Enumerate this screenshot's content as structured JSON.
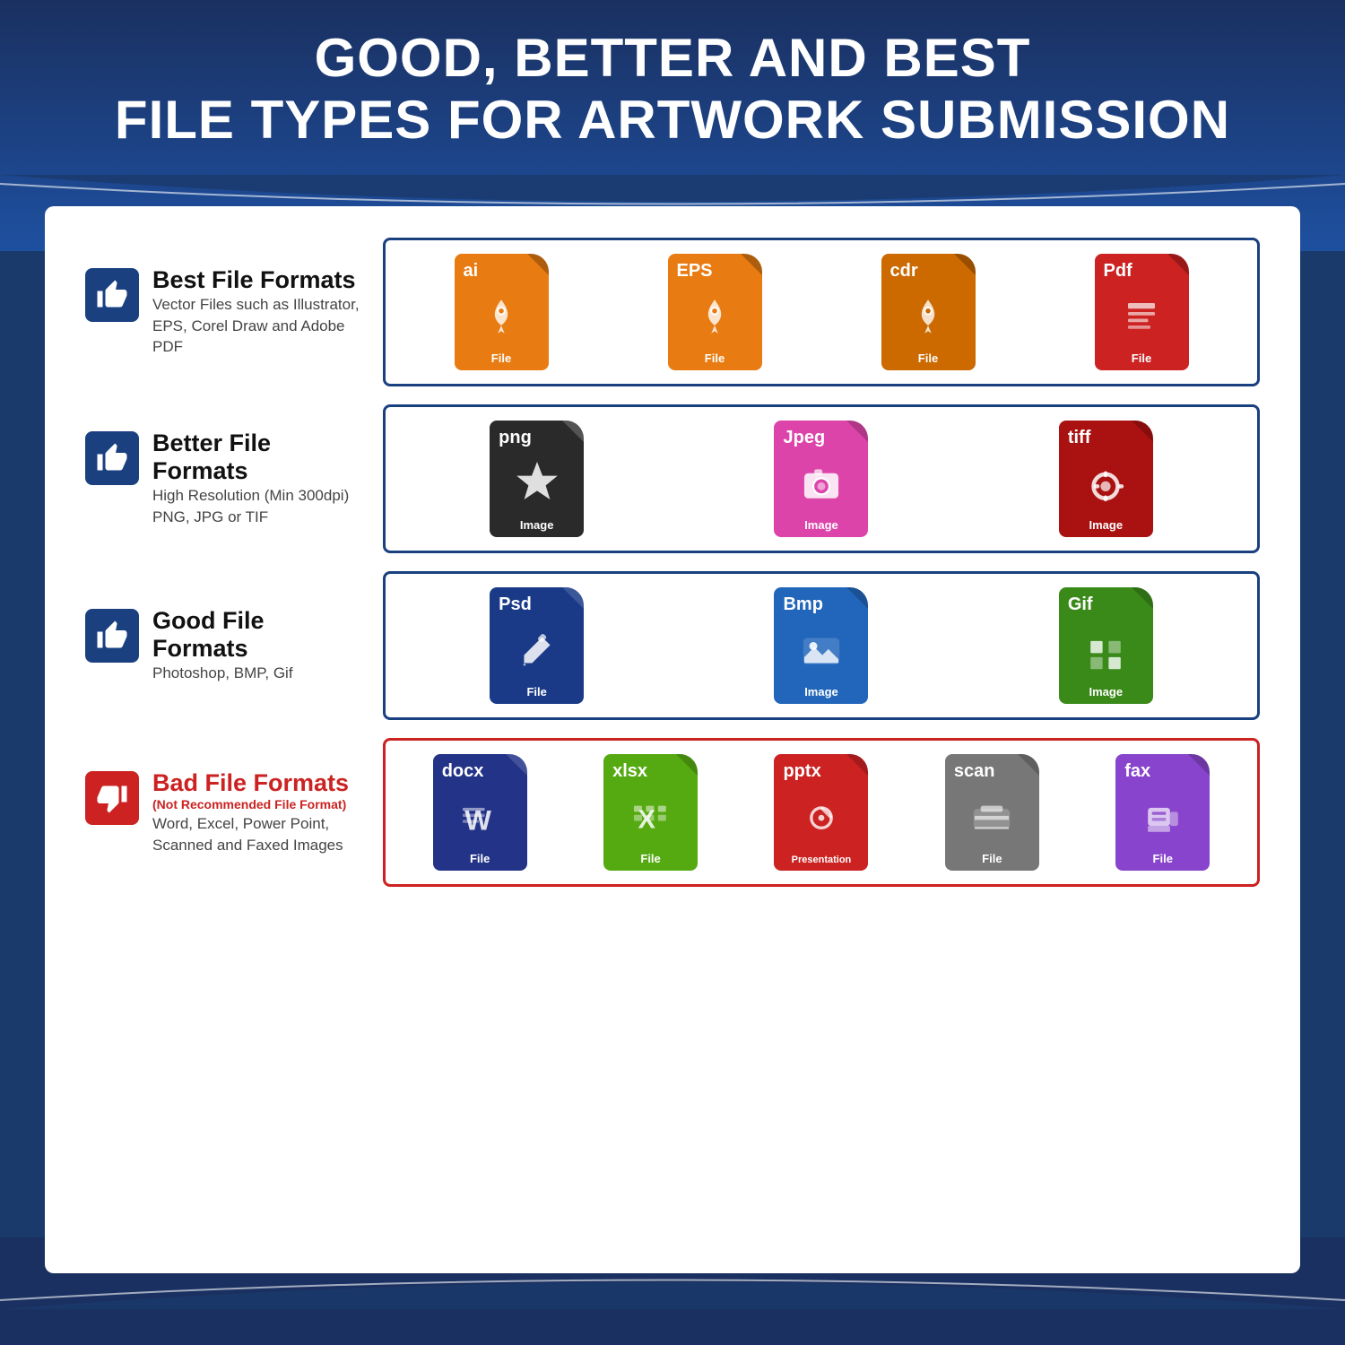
{
  "page": {
    "title_line1": "GOOD, BETTER AND BEST",
    "title_line2": "FILE TYPES FOR ARTWORK SUBMISSION"
  },
  "rows": [
    {
      "id": "best",
      "thumb": "thumbs-up",
      "thumb_bg": "blue",
      "title": "Best File Formats",
      "subtitle": null,
      "description": "Vector Files such as Illustrator, EPS, Corel Draw and Adobe PDF",
      "border": "blue",
      "files": [
        {
          "ext": "ai",
          "color": "fc-orange",
          "label": "File",
          "icon": "pen"
        },
        {
          "ext": "EPS",
          "color": "fc-orange",
          "label": "File",
          "icon": "pen"
        },
        {
          "ext": "cdr",
          "color": "fc-darkorange",
          "label": "File",
          "icon": "pen"
        },
        {
          "ext": "Pdf",
          "color": "fc-red",
          "label": "File",
          "icon": "doc"
        }
      ]
    },
    {
      "id": "better",
      "thumb": "thumbs-up",
      "thumb_bg": "blue",
      "title": "Better File Formats",
      "subtitle": null,
      "description": "High Resolution (Min 300dpi) PNG, JPG or TIF",
      "border": "blue",
      "files": [
        {
          "ext": "png",
          "color": "fc-darkgray",
          "label": "Image",
          "icon": "star"
        },
        {
          "ext": "Jpeg",
          "color": "fc-pink",
          "label": "Image",
          "icon": "camera"
        },
        {
          "ext": "tiff",
          "color": "fc-darkred",
          "label": "Image",
          "icon": "gear"
        }
      ]
    },
    {
      "id": "good",
      "thumb": "thumbs-up",
      "thumb_bg": "blue",
      "title": "Good File Formats",
      "subtitle": null,
      "description": "Photoshop, BMP, Gif",
      "border": "blue",
      "files": [
        {
          "ext": "Psd",
          "color": "fc-darkblue",
          "label": "File",
          "icon": "brush"
        },
        {
          "ext": "Bmp",
          "color": "fc-blue",
          "label": "Image",
          "icon": "image"
        },
        {
          "ext": "Gif",
          "color": "fc-green",
          "label": "Image",
          "icon": "grid"
        }
      ]
    },
    {
      "id": "bad",
      "thumb": "thumbs-down",
      "thumb_bg": "red",
      "title": "Bad File Formats",
      "subtitle": "(Not Recommended File Format)",
      "description": "Word, Excel, Power Point, Scanned and Faxed Images",
      "border": "red",
      "files": [
        {
          "ext": "docx",
          "color": "fc-navy",
          "label": "File",
          "icon": "word"
        },
        {
          "ext": "xlsx",
          "color": "fc-limegreen",
          "label": "File",
          "icon": "excel"
        },
        {
          "ext": "pptx",
          "color": "fc-red",
          "label": "Presentation",
          "icon": "ppt"
        },
        {
          "ext": "scan",
          "color": "fc-medgray",
          "label": "File",
          "icon": "scan"
        },
        {
          "ext": "fax",
          "color": "fc-purple",
          "label": "File",
          "icon": "fax"
        }
      ]
    }
  ]
}
